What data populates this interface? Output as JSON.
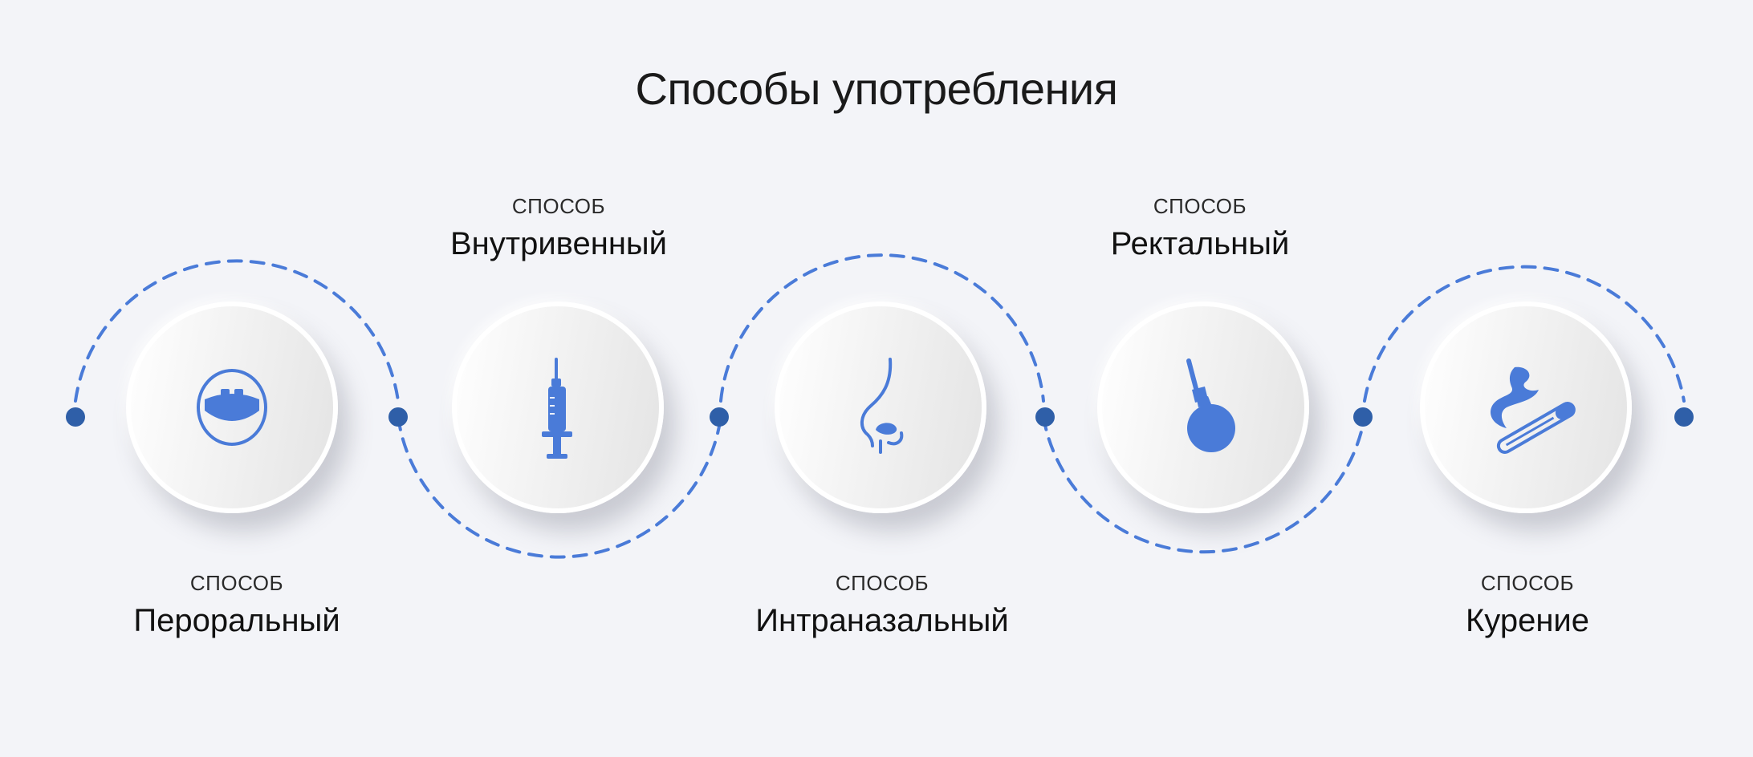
{
  "title": "Способы употребления",
  "accent_color": "#4a7bd8",
  "node_color": "#2f5fa8",
  "steps": [
    {
      "kicker": "СПОСОБ",
      "name": "Пероральный",
      "icon": "mouth-icon"
    },
    {
      "kicker": "СПОСОБ",
      "name": "Внутривенный",
      "icon": "syringe-icon"
    },
    {
      "kicker": "СПОСОБ",
      "name": "Интраназальный",
      "icon": "nose-icon"
    },
    {
      "kicker": "СПОСОБ",
      "name": "Ректальный",
      "icon": "enema-bulb-icon"
    },
    {
      "kicker": "СПОСОБ",
      "name": "Курение",
      "icon": "cigarette-icon"
    }
  ]
}
